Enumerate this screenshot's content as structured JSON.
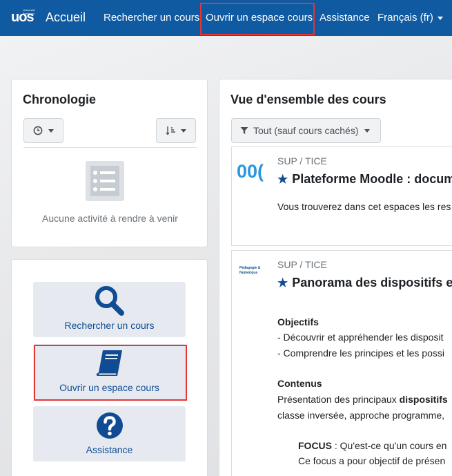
{
  "navbar": {
    "logo_text": "uos",
    "logo_small_text": "Université Bordeaux",
    "title": "Accueil",
    "links": [
      "Rechercher un cours",
      "Ouvrir un espace cours",
      "Assistance"
    ],
    "language": "Français (fr)"
  },
  "timeline": {
    "title": "Chronologie",
    "empty_message": "Aucune activité à rendre à venir"
  },
  "quick_links": [
    {
      "label": "Rechercher un cours",
      "icon": "search-icon"
    },
    {
      "label": "Ouvrir un espace cours",
      "icon": "book-icon"
    },
    {
      "label": "Assistance",
      "icon": "question-circle-icon"
    }
  ],
  "overview": {
    "title": "Vue d'ensemble des cours",
    "filter_label": "Tout (sauf cours cachés)"
  },
  "courses": [
    {
      "category": "SUP / TICE",
      "name": "Plateforme Moodle : docum",
      "summary": "Vous trouverez dans cet espaces les res",
      "thumb_text": "00("
    },
    {
      "category": "SUP / TICE",
      "name": "Panorama des dispositifs et",
      "thumb_text": "Pédagogie & Numérique",
      "objectifs_title": "Objectifs",
      "objectifs_1": "- Découvrir et appréhender les disposit",
      "objectifs_2": "- Comprendre les principes et les possi",
      "contenus_title": "Contenus",
      "contenus_1_prefix": "Présentation des principaux ",
      "contenus_1_bold": "dispositifs",
      "contenus_2": "classe inversée, approche programme,",
      "focus_bold": "FOCUS",
      "focus_rest": " : Qu'est-ce qu'un cours en",
      "focus_2": "Ce focus a pour objectif de présen"
    }
  ],
  "colors": {
    "navbar": "#0f5aa0",
    "accent": "#0f4c94",
    "highlight": "#e53535"
  }
}
